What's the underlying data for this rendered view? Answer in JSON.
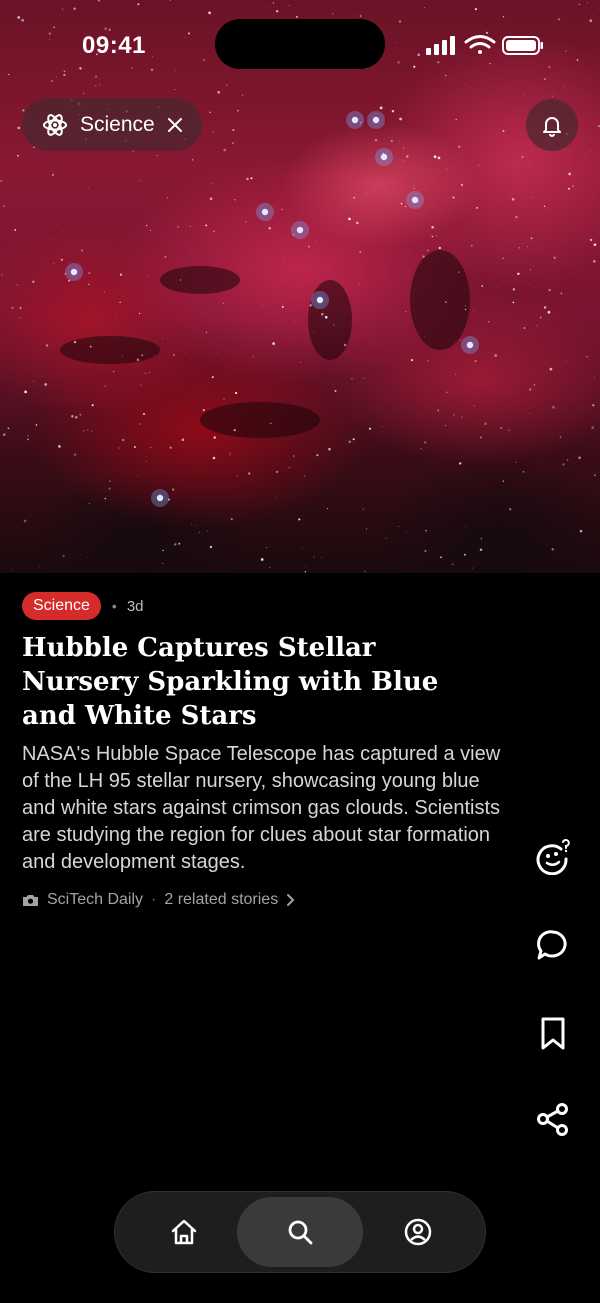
{
  "status_bar": {
    "time": "09:41"
  },
  "topic_chip": {
    "label": "Science",
    "icon": "atom-icon"
  },
  "header": {
    "bell_icon": "bell-icon"
  },
  "article": {
    "category": "Science",
    "age": "3d",
    "headline": "Hubble Captures Stellar Nursery Sparkling with Blue and White Stars",
    "summary": "NASA's Hubble Space Telescope has captured a view of the LH 95 stellar nursery, showcasing young blue and white stars against crimson gas clouds. Scientists are studying the region for clues about star formation and development stages.",
    "source": "SciTech Daily",
    "related": "2 related stories"
  },
  "actions": [
    "ai-summary-icon",
    "comment-icon",
    "bookmark-icon",
    "share-icon"
  ],
  "tabbar": {
    "tabs": [
      "home",
      "search",
      "profile"
    ],
    "active": "search"
  },
  "colors": {
    "badge": "#d62b2b",
    "background": "#000000",
    "tabbar": "#1e1e1e"
  }
}
